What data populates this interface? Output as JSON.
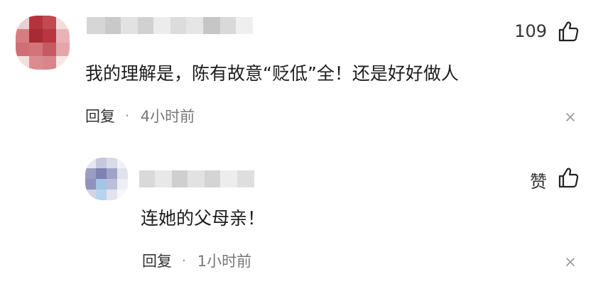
{
  "comments": [
    {
      "avatar_icon": "pixelated-avatar",
      "username_censored": true,
      "like_count": "109",
      "text": "我的理解是，陈有故意“贬低”全！还是好好做人",
      "reply_label": "回复",
      "separator": "·",
      "time": "4小时前"
    },
    {
      "avatar_icon": "pixelated-avatar",
      "username_censored": true,
      "like_label": "赞",
      "text": "连她的父母亲！",
      "reply_label": "回复",
      "separator": "·",
      "time": "1小时前"
    }
  ],
  "icons": {
    "like": "thumbs-up-icon",
    "close": "close-icon"
  },
  "colors": {
    "text": "#1c1c1c",
    "meta": "#777777",
    "avatar1_primary": "#b0353c",
    "avatar2_primary": "#8c8fb8"
  }
}
